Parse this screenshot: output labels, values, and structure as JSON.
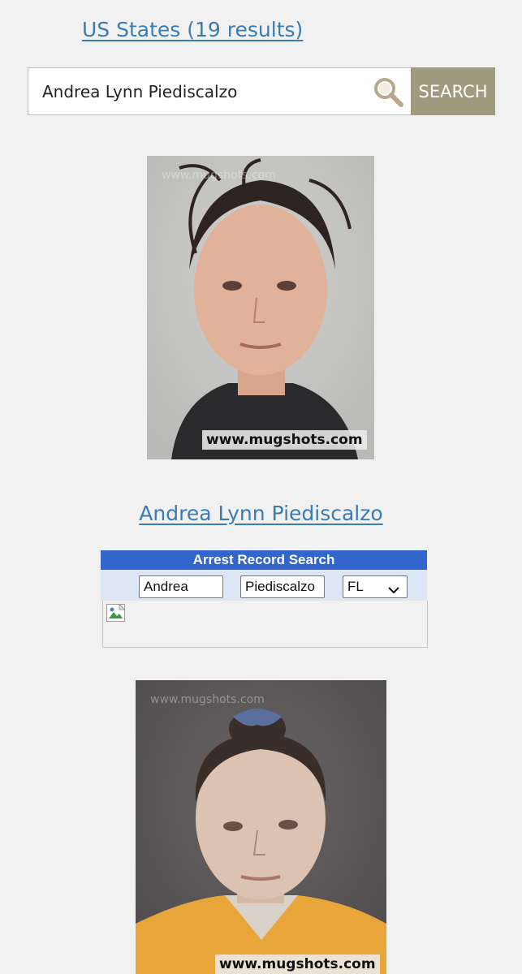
{
  "header": {
    "results_link": "US States (19 results)"
  },
  "search": {
    "value": "Andrea Lynn Piediscalzo",
    "button_label": "SEARCH",
    "icon": "search-icon"
  },
  "result": {
    "photo_1": {
      "watermark_top": "www.mugshots.com",
      "watermark_badge": "www.mugshots.com"
    },
    "name_link": "Andrea Lynn Piediscalzo"
  },
  "arrest_search": {
    "title": "Arrest Record Search",
    "first_name": "Andrea",
    "last_name": "Piediscalzo",
    "state": "FL",
    "header_color": "#3366cc"
  },
  "photo_2": {
    "watermark_top": "www.mugshots.com",
    "watermark_badge": "www.mugshots.com"
  },
  "colors": {
    "link": "#3a7bb5",
    "search_button": "#a09a7f",
    "background": "#f1f1f1"
  }
}
